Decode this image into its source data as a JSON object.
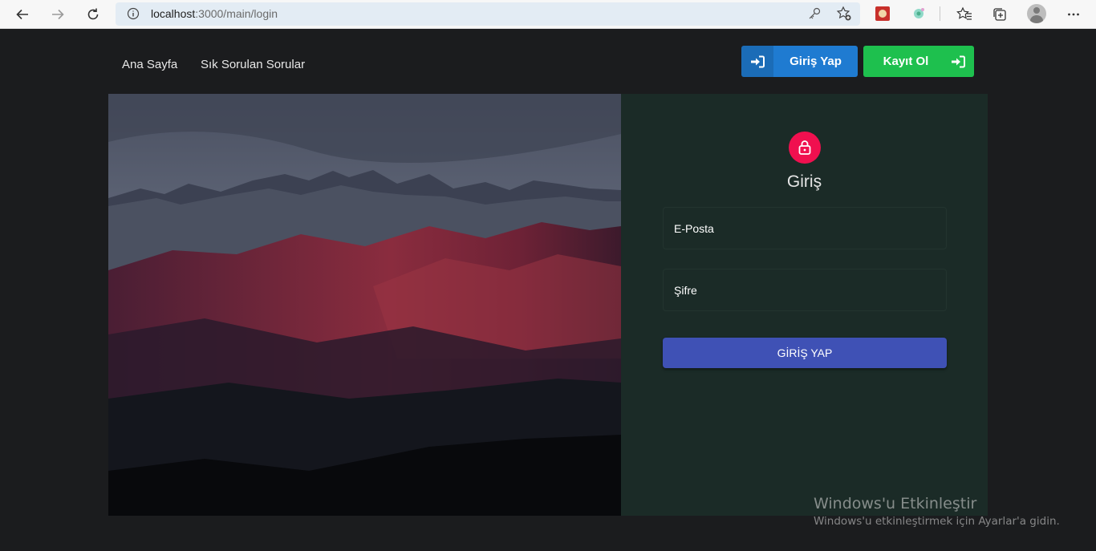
{
  "browser": {
    "url_host": "localhost",
    "url_path": ":3000/main/login"
  },
  "nav": {
    "home": "Ana Sayfa",
    "faq": "Sık Sorulan Sorular",
    "login_button": "Giriş Yap",
    "register_button": "Kayıt Ol"
  },
  "form": {
    "title": "Giriş",
    "email_placeholder": "E-Posta",
    "password_placeholder": "Şifre",
    "submit_label": "GİRİŞ YAP"
  },
  "watermark": {
    "title": "Windows'u Etkinleştir",
    "subtitle": "Windows'u etkinleştirmek için Ayarlar'a gidin."
  },
  "colors": {
    "login_btn": "#1f7bd1",
    "register_btn": "#1ec04e",
    "lock_badge": "#f0104f",
    "submit_btn": "#3f51b5",
    "panel_bg": "#1b2b27"
  }
}
